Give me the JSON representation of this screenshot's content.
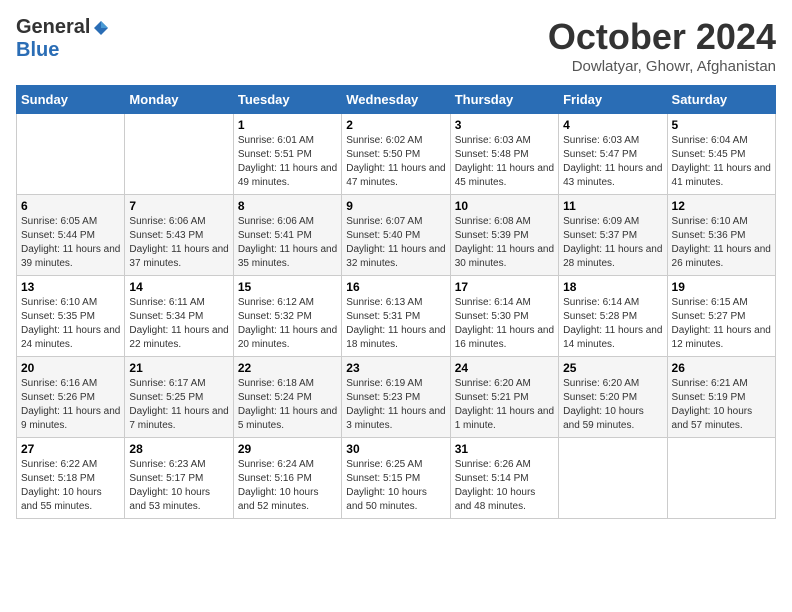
{
  "logo": {
    "general": "General",
    "blue": "Blue"
  },
  "title": "October 2024",
  "location": "Dowlatyar, Ghowr, Afghanistan",
  "days_header": [
    "Sunday",
    "Monday",
    "Tuesday",
    "Wednesday",
    "Thursday",
    "Friday",
    "Saturday"
  ],
  "weeks": [
    [
      {
        "day": "",
        "sunrise": "",
        "sunset": "",
        "daylight": ""
      },
      {
        "day": "",
        "sunrise": "",
        "sunset": "",
        "daylight": ""
      },
      {
        "day": "1",
        "sunrise": "Sunrise: 6:01 AM",
        "sunset": "Sunset: 5:51 PM",
        "daylight": "Daylight: 11 hours and 49 minutes."
      },
      {
        "day": "2",
        "sunrise": "Sunrise: 6:02 AM",
        "sunset": "Sunset: 5:50 PM",
        "daylight": "Daylight: 11 hours and 47 minutes."
      },
      {
        "day": "3",
        "sunrise": "Sunrise: 6:03 AM",
        "sunset": "Sunset: 5:48 PM",
        "daylight": "Daylight: 11 hours and 45 minutes."
      },
      {
        "day": "4",
        "sunrise": "Sunrise: 6:03 AM",
        "sunset": "Sunset: 5:47 PM",
        "daylight": "Daylight: 11 hours and 43 minutes."
      },
      {
        "day": "5",
        "sunrise": "Sunrise: 6:04 AM",
        "sunset": "Sunset: 5:45 PM",
        "daylight": "Daylight: 11 hours and 41 minutes."
      }
    ],
    [
      {
        "day": "6",
        "sunrise": "Sunrise: 6:05 AM",
        "sunset": "Sunset: 5:44 PM",
        "daylight": "Daylight: 11 hours and 39 minutes."
      },
      {
        "day": "7",
        "sunrise": "Sunrise: 6:06 AM",
        "sunset": "Sunset: 5:43 PM",
        "daylight": "Daylight: 11 hours and 37 minutes."
      },
      {
        "day": "8",
        "sunrise": "Sunrise: 6:06 AM",
        "sunset": "Sunset: 5:41 PM",
        "daylight": "Daylight: 11 hours and 35 minutes."
      },
      {
        "day": "9",
        "sunrise": "Sunrise: 6:07 AM",
        "sunset": "Sunset: 5:40 PM",
        "daylight": "Daylight: 11 hours and 32 minutes."
      },
      {
        "day": "10",
        "sunrise": "Sunrise: 6:08 AM",
        "sunset": "Sunset: 5:39 PM",
        "daylight": "Daylight: 11 hours and 30 minutes."
      },
      {
        "day": "11",
        "sunrise": "Sunrise: 6:09 AM",
        "sunset": "Sunset: 5:37 PM",
        "daylight": "Daylight: 11 hours and 28 minutes."
      },
      {
        "day": "12",
        "sunrise": "Sunrise: 6:10 AM",
        "sunset": "Sunset: 5:36 PM",
        "daylight": "Daylight: 11 hours and 26 minutes."
      }
    ],
    [
      {
        "day": "13",
        "sunrise": "Sunrise: 6:10 AM",
        "sunset": "Sunset: 5:35 PM",
        "daylight": "Daylight: 11 hours and 24 minutes."
      },
      {
        "day": "14",
        "sunrise": "Sunrise: 6:11 AM",
        "sunset": "Sunset: 5:34 PM",
        "daylight": "Daylight: 11 hours and 22 minutes."
      },
      {
        "day": "15",
        "sunrise": "Sunrise: 6:12 AM",
        "sunset": "Sunset: 5:32 PM",
        "daylight": "Daylight: 11 hours and 20 minutes."
      },
      {
        "day": "16",
        "sunrise": "Sunrise: 6:13 AM",
        "sunset": "Sunset: 5:31 PM",
        "daylight": "Daylight: 11 hours and 18 minutes."
      },
      {
        "day": "17",
        "sunrise": "Sunrise: 6:14 AM",
        "sunset": "Sunset: 5:30 PM",
        "daylight": "Daylight: 11 hours and 16 minutes."
      },
      {
        "day": "18",
        "sunrise": "Sunrise: 6:14 AM",
        "sunset": "Sunset: 5:28 PM",
        "daylight": "Daylight: 11 hours and 14 minutes."
      },
      {
        "day": "19",
        "sunrise": "Sunrise: 6:15 AM",
        "sunset": "Sunset: 5:27 PM",
        "daylight": "Daylight: 11 hours and 12 minutes."
      }
    ],
    [
      {
        "day": "20",
        "sunrise": "Sunrise: 6:16 AM",
        "sunset": "Sunset: 5:26 PM",
        "daylight": "Daylight: 11 hours and 9 minutes."
      },
      {
        "day": "21",
        "sunrise": "Sunrise: 6:17 AM",
        "sunset": "Sunset: 5:25 PM",
        "daylight": "Daylight: 11 hours and 7 minutes."
      },
      {
        "day": "22",
        "sunrise": "Sunrise: 6:18 AM",
        "sunset": "Sunset: 5:24 PM",
        "daylight": "Daylight: 11 hours and 5 minutes."
      },
      {
        "day": "23",
        "sunrise": "Sunrise: 6:19 AM",
        "sunset": "Sunset: 5:23 PM",
        "daylight": "Daylight: 11 hours and 3 minutes."
      },
      {
        "day": "24",
        "sunrise": "Sunrise: 6:20 AM",
        "sunset": "Sunset: 5:21 PM",
        "daylight": "Daylight: 11 hours and 1 minute."
      },
      {
        "day": "25",
        "sunrise": "Sunrise: 6:20 AM",
        "sunset": "Sunset: 5:20 PM",
        "daylight": "Daylight: 10 hours and 59 minutes."
      },
      {
        "day": "26",
        "sunrise": "Sunrise: 6:21 AM",
        "sunset": "Sunset: 5:19 PM",
        "daylight": "Daylight: 10 hours and 57 minutes."
      }
    ],
    [
      {
        "day": "27",
        "sunrise": "Sunrise: 6:22 AM",
        "sunset": "Sunset: 5:18 PM",
        "daylight": "Daylight: 10 hours and 55 minutes."
      },
      {
        "day": "28",
        "sunrise": "Sunrise: 6:23 AM",
        "sunset": "Sunset: 5:17 PM",
        "daylight": "Daylight: 10 hours and 53 minutes."
      },
      {
        "day": "29",
        "sunrise": "Sunrise: 6:24 AM",
        "sunset": "Sunset: 5:16 PM",
        "daylight": "Daylight: 10 hours and 52 minutes."
      },
      {
        "day": "30",
        "sunrise": "Sunrise: 6:25 AM",
        "sunset": "Sunset: 5:15 PM",
        "daylight": "Daylight: 10 hours and 50 minutes."
      },
      {
        "day": "31",
        "sunrise": "Sunrise: 6:26 AM",
        "sunset": "Sunset: 5:14 PM",
        "daylight": "Daylight: 10 hours and 48 minutes."
      },
      {
        "day": "",
        "sunrise": "",
        "sunset": "",
        "daylight": ""
      },
      {
        "day": "",
        "sunrise": "",
        "sunset": "",
        "daylight": ""
      }
    ]
  ]
}
